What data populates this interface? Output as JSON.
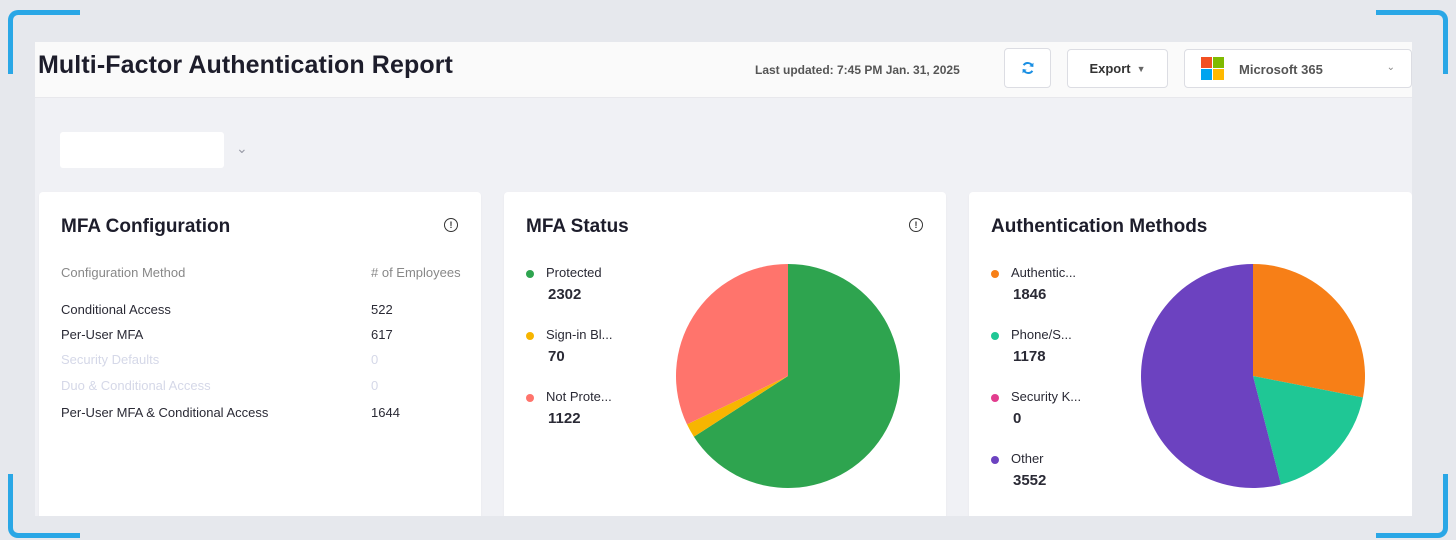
{
  "header": {
    "title": "Multi-Factor Authentication Report",
    "last_updated": "Last updated: 7:45 PM Jan. 31, 2025",
    "export_label": "Export",
    "tenant_label": "Microsoft 365"
  },
  "filter": {
    "value": ""
  },
  "colors": {
    "protected": "#2ea44f",
    "sign_in_blocked": "#f7b500",
    "not_protected": "#ff746c",
    "authenticator": "#f77f17",
    "phone": "#1fc795",
    "security_key": "#e23d8e",
    "other": "#6c42c0",
    "refresh_icon": "#1a8fe3",
    "corner": "#2aa7e6"
  },
  "mfa_config": {
    "title": "MFA Configuration",
    "col_method": "Configuration Method",
    "col_employees": "# of Employees",
    "rows": [
      {
        "method": "Conditional Access",
        "count": "522",
        "dimmed": false
      },
      {
        "method": "Per-User MFA",
        "count": "617",
        "dimmed": false
      },
      {
        "method": "Security Defaults",
        "count": "0",
        "dimmed": true
      },
      {
        "method": "Duo & Conditional Access",
        "count": "0",
        "dimmed": true
      },
      {
        "method": "Per-User MFA & Conditional Access",
        "count": "1644",
        "dimmed": false
      }
    ]
  },
  "mfa_status": {
    "title": "MFA Status",
    "legend": [
      {
        "label": "Protected",
        "value": "2302",
        "color": "#2ea44f"
      },
      {
        "label": "Sign-in Bl...",
        "value": "70",
        "color": "#f7b500"
      },
      {
        "label": "Not Prote...",
        "value": "1122",
        "color": "#ff746c"
      }
    ]
  },
  "auth_methods": {
    "title": "Authentication Methods",
    "legend": [
      {
        "label": "Authentic...",
        "value": "1846",
        "color": "#f77f17"
      },
      {
        "label": "Phone/S...",
        "value": "1178",
        "color": "#1fc795"
      },
      {
        "label": "Security K...",
        "value": "0",
        "color": "#e23d8e"
      },
      {
        "label": "Other",
        "value": "3552",
        "color": "#6c42c0"
      }
    ]
  },
  "chart_data": [
    {
      "type": "pie",
      "title": "MFA Status",
      "categories": [
        "Protected",
        "Sign-in Bl...",
        "Not Prote..."
      ],
      "values": [
        2302,
        70,
        1122
      ]
    },
    {
      "type": "pie",
      "title": "Authentication Methods",
      "categories": [
        "Authentic...",
        "Phone/S...",
        "Security K...",
        "Other"
      ],
      "values": [
        1846,
        1178,
        0,
        3552
      ]
    }
  ]
}
